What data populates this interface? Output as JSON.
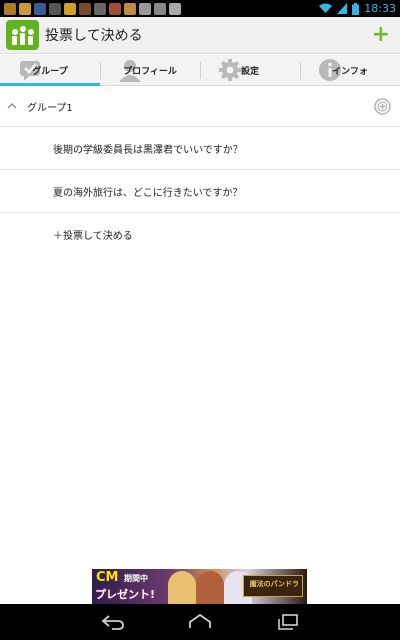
{
  "status_bar": {
    "time": "18:33",
    "notification_icons": [
      "game-icon",
      "game-icon",
      "facebook-icon",
      "phone-icon",
      "game-icon",
      "game-icon",
      "download-icon",
      "game-icon",
      "game-icon",
      "cloud-icon",
      "check-icon",
      "play-store-icon"
    ],
    "accent_color": "#33b5e5"
  },
  "action_bar": {
    "title": "投票して決める",
    "add_label": "+",
    "accent_color": "#76b82a"
  },
  "tabs": [
    {
      "label": "グループ",
      "icon": "speech-check-icon",
      "selected": true
    },
    {
      "label": "プロフィール",
      "icon": "person-icon",
      "selected": false
    },
    {
      "label": "設定",
      "icon": "gear-icon",
      "selected": false
    },
    {
      "label": "インフォ",
      "icon": "info-icon",
      "selected": false
    }
  ],
  "group": {
    "label": "グループ1",
    "expanded_icon": "chevron-up-icon",
    "add_icon": "add-circle-icon"
  },
  "polls": [
    {
      "text": "後期の学級委員長は黒澤君でいいですか？"
    },
    {
      "text": "夏の海外旅行は、どこに行きたいですか？"
    }
  ],
  "add_poll_label": "＋投票して決める",
  "ad": {
    "cm_label": "CM",
    "period_label": "期間中",
    "present_label": "プレゼント!",
    "logo_text": "魔法のパンドラ"
  },
  "nav_bar": {
    "buttons": [
      "back-icon",
      "home-icon",
      "recents-icon"
    ]
  }
}
